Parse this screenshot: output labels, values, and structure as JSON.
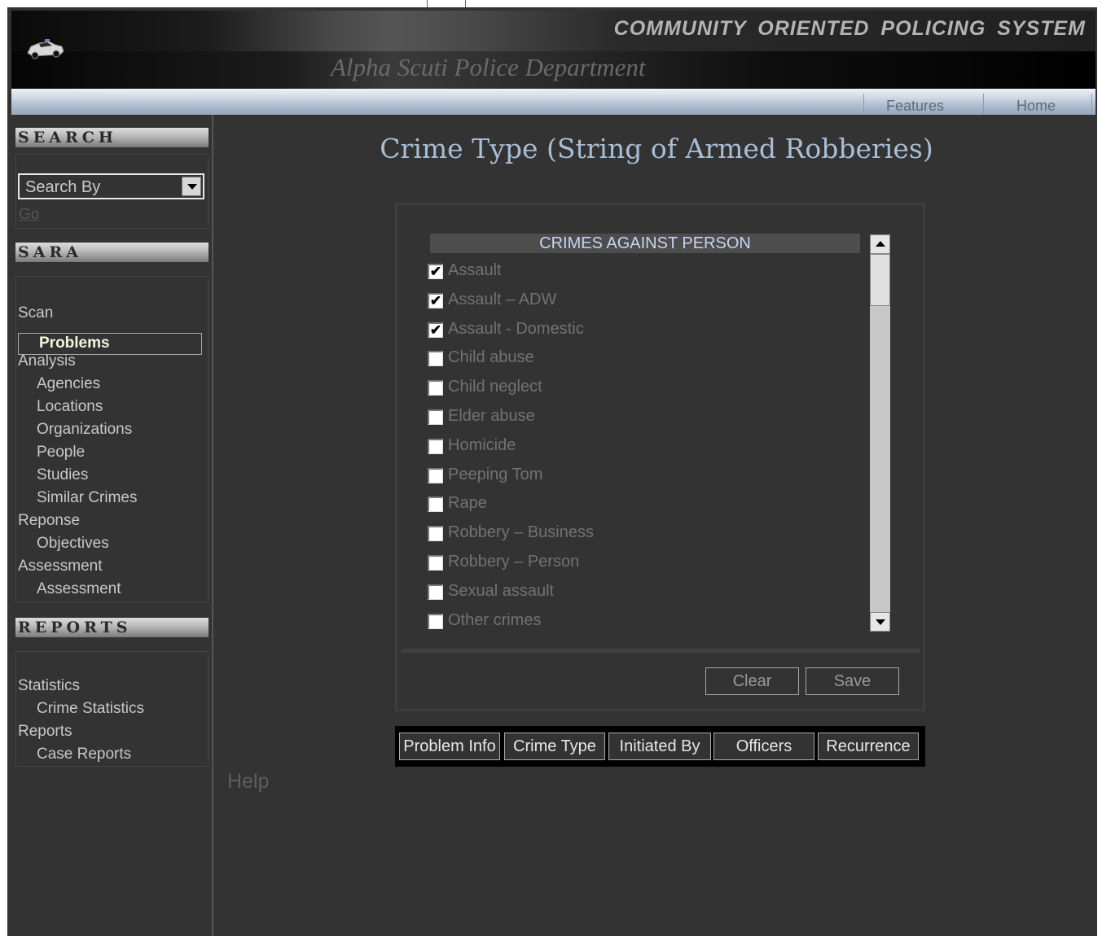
{
  "header": {
    "system_title": "COMMUNITY  ORIENTED  POLICING  SYSTEM",
    "department": "Alpha Scuti Police Department",
    "logo_icon": "police-car-icon"
  },
  "nav": {
    "features": "Features",
    "home": "Home"
  },
  "sidebar": {
    "search": {
      "heading": "SEARCH",
      "select_value": "Search By",
      "go_label": "Go"
    },
    "sara": {
      "heading": "SARA",
      "items": [
        {
          "label": "Scan",
          "level": 1
        },
        {
          "label": "Problems",
          "level": 2,
          "selected": true
        },
        {
          "label": "Analysis",
          "level": 1
        },
        {
          "label": "Agencies",
          "level": 2
        },
        {
          "label": "Locations",
          "level": 2
        },
        {
          "label": "Organizations",
          "level": 2
        },
        {
          "label": "People",
          "level": 2
        },
        {
          "label": "Studies",
          "level": 2
        },
        {
          "label": "Similar Crimes",
          "level": 2
        },
        {
          "label": "Reponse",
          "level": 1
        },
        {
          "label": "Objectives",
          "level": 2
        },
        {
          "label": "Assessment",
          "level": 1
        },
        {
          "label": "Assessment",
          "level": 2
        }
      ]
    },
    "reports": {
      "heading": "REPORTS",
      "items": [
        {
          "label": "Statistics",
          "level": 1
        },
        {
          "label": "Crime Statistics",
          "level": 2
        },
        {
          "label": "Reports",
          "level": 1
        },
        {
          "label": "Case Reports",
          "level": 2
        }
      ]
    }
  },
  "main": {
    "title": "Crime Type (String of Armed Robberies)",
    "list_header": "CRIMES AGAINST PERSON",
    "crimes": [
      {
        "label": "Assault",
        "checked": true
      },
      {
        "label": "Assault – ADW",
        "checked": true
      },
      {
        "label": "Assault - Domestic",
        "checked": true
      },
      {
        "label": "Child abuse",
        "checked": false
      },
      {
        "label": "Child neglect",
        "checked": false
      },
      {
        "label": "Elder abuse",
        "checked": false
      },
      {
        "label": "Homicide",
        "checked": false
      },
      {
        "label": "Peeping Tom",
        "checked": false
      },
      {
        "label": "Rape",
        "checked": false
      },
      {
        "label": "Robbery – Business",
        "checked": false
      },
      {
        "label": "Robbery – Person",
        "checked": false
      },
      {
        "label": "Sexual assault",
        "checked": false
      },
      {
        "label": "Other crimes",
        "checked": false
      }
    ],
    "clear_label": "Clear",
    "save_label": "Save",
    "tabs": [
      "Problem Info",
      "Crime Type",
      "Initiated By",
      "Officers",
      "Recurrence"
    ],
    "help": "Help"
  },
  "colors": {
    "background": "#333333",
    "title": "#a9bdd5",
    "selected_nav": "#f5f5dc"
  }
}
